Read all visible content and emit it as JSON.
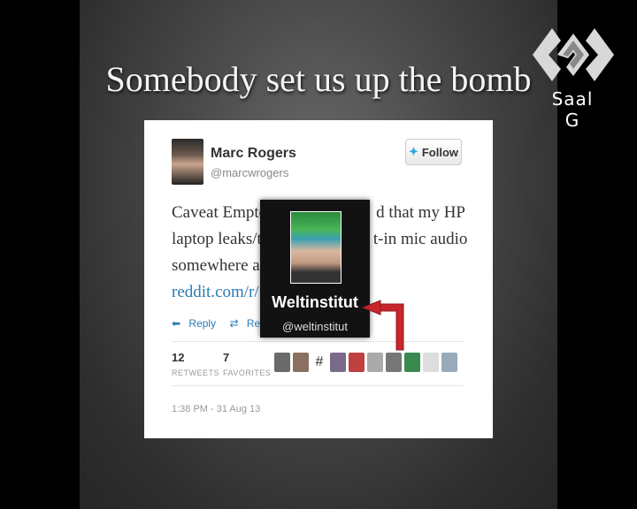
{
  "slide": {
    "title": "Somebody set us up the bomb"
  },
  "room": {
    "label": "Saal G"
  },
  "tweet": {
    "author_name": "Marc Rogers",
    "author_handle": "@marcwrogers",
    "follow_label": "Follow",
    "line1_a": "Caveat Empto",
    "line1_b": "d that my HP",
    "line2_a": "laptop leaks/t",
    "line2_b": "t-in mic audio",
    "line3": "somewhere ar",
    "link": "reddit.com/r/",
    "reply_label": "Reply",
    "retweet_label": "Retweet",
    "retweets_count": "12",
    "retweets_label": "RETWEETS",
    "favorites_count": "7",
    "favorites_label": "FAVORITES",
    "timestamp": "1:38 PM - 31 Aug 13"
  },
  "profile_popup": {
    "name": "Weltinstitut",
    "handle": "@weltinstitut"
  },
  "colors": {
    "accent": "#2a7bb6",
    "arrow": "#c8262c",
    "background": "#000000"
  }
}
